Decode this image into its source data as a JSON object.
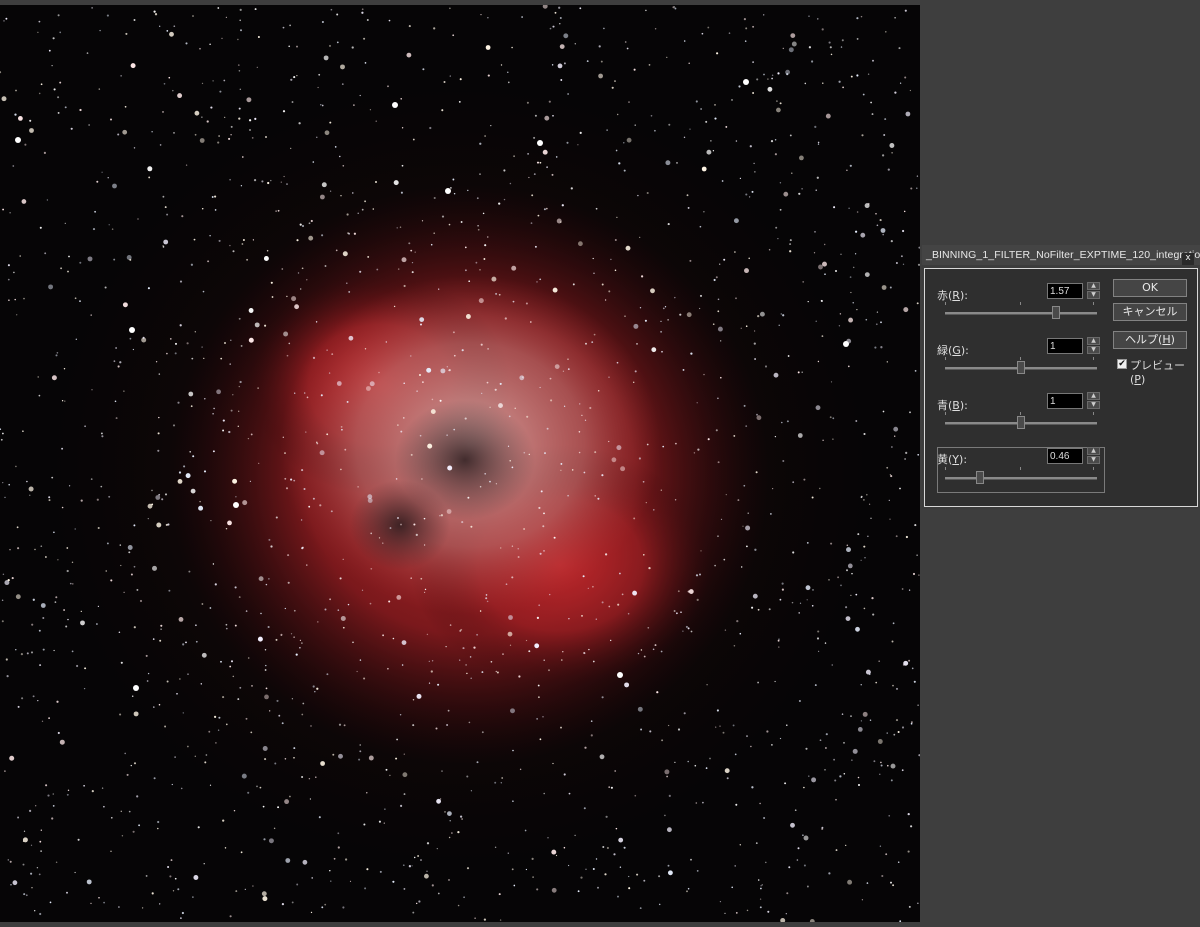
{
  "dialog": {
    "title": "_BINNING_1_FILTER_NoFilter_EXPTIME_120_integratio",
    "close_glyph": "x",
    "sliders": [
      {
        "label": "赤(",
        "key": "R",
        "suffix": "):",
        "value": "1.57",
        "level": 0.73
      },
      {
        "label": "緑(",
        "key": "G",
        "suffix": "):",
        "value": "1",
        "level": 0.5
      },
      {
        "label": "青(",
        "key": "B",
        "suffix": "):",
        "value": "1",
        "level": 0.5
      }
    ],
    "yellow": {
      "label": "黄(",
      "key": "Y",
      "suffix": "):",
      "value": "0.46",
      "level": 0.23
    },
    "buttons": {
      "ok": "OK",
      "cancel": "キャンセル",
      "help_label": "ヘルプ(",
      "help_key": "H",
      "help_suffix": ")"
    },
    "preview": {
      "label": "プレビュー(",
      "key": "P",
      "suffix": ")",
      "checked": true,
      "check_glyph": "✔"
    }
  },
  "colors": {
    "workspace": "#3e3e3e",
    "nebula": "#c0282c",
    "sky": "#050405"
  },
  "icons": {
    "close": "close-icon",
    "spin_up": "chevron-up-icon",
    "spin_down": "chevron-down-icon"
  }
}
